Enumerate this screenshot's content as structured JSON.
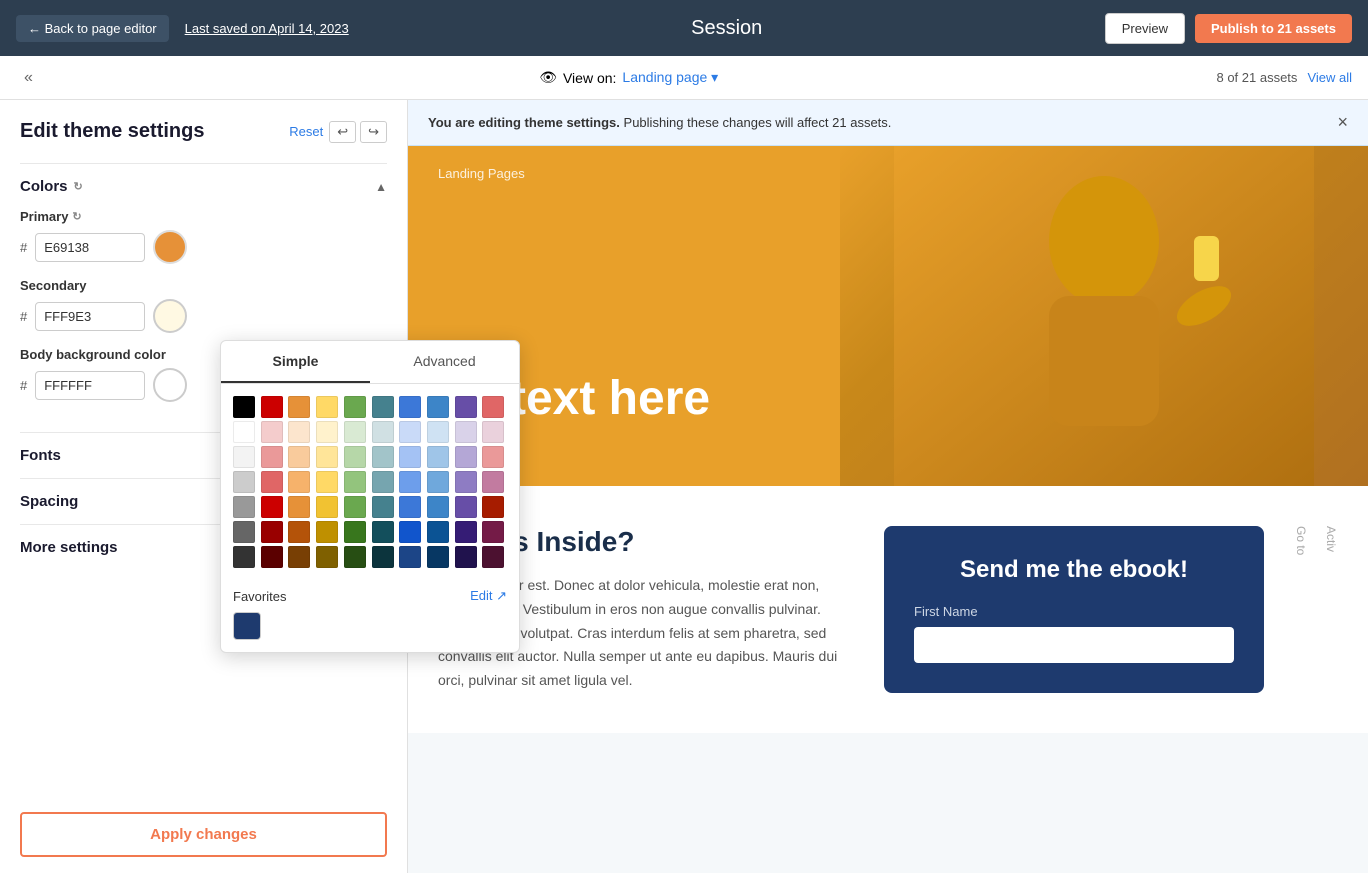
{
  "topbar": {
    "back_label": "← Back to page editor",
    "last_saved": "Last saved on April 14, 2023",
    "title": "Session",
    "preview_label": "Preview",
    "publish_label": "Publish to 21 assets"
  },
  "secondbar": {
    "collapse_icon": "«",
    "eye_icon": "👁",
    "view_on_prefix": "View on:",
    "view_on_value": "Landing page ▾",
    "assets_count": "8 of 21 assets",
    "view_all": "View all"
  },
  "sidebar": {
    "edit_theme_title": "Edit theme settings",
    "reset_label": "Reset",
    "undo_label": "↩",
    "redo_label": "↪",
    "sections": {
      "colors": {
        "label": "Colors",
        "chevron": "▲",
        "primary_label": "Primary",
        "primary_value": "E69138",
        "primary_color": "#E69138",
        "secondary_label": "Secondary",
        "secondary_value": "FFF9E3",
        "secondary_color": "#FFF9E3",
        "bg_label": "Body background color",
        "bg_value": "FFFFFF",
        "bg_color": "#FFFFFF"
      },
      "fonts": {
        "label": "Fonts",
        "chevron": "▶"
      },
      "spacing": {
        "label": "Spacing",
        "chevron": "▼"
      },
      "more": {
        "label": "More settings",
        "chevron": "›"
      }
    },
    "apply_label": "Apply changes"
  },
  "color_picker": {
    "tab_simple": "Simple",
    "tab_advanced": "Advanced",
    "favorites_label": "Favorites",
    "edit_label": "Edit ↗",
    "colors_row1": [
      "#000000",
      "#cc0000",
      "#e69138",
      "#ffd966",
      "#6aa84f",
      "#45818e",
      "#3c78d8",
      "#3d85c8",
      "#674ea7",
      "#e06666"
    ],
    "colors_row2": [
      "#ffffff",
      "#f4cccc",
      "#fce5cd",
      "#fff2cc",
      "#d9ead3",
      "#d0e0e3",
      "#c9daf8",
      "#cfe2f3",
      "#d9d2e9",
      "#ead1dc"
    ],
    "colors_row3": [
      "#f3f3f3",
      "#ea9999",
      "#f9cb9c",
      "#ffe599",
      "#b6d7a8",
      "#a2c4c9",
      "#a4c2f4",
      "#9fc5e8",
      "#b4a7d6",
      "#ea9999"
    ],
    "colors_row4": [
      "#cccccc",
      "#e06666",
      "#f6b26b",
      "#ffd966",
      "#93c47d",
      "#76a5af",
      "#6d9eeb",
      "#6fa8dc",
      "#8e7cc3",
      "#c27ba0"
    ],
    "colors_row5": [
      "#999999",
      "#cc0000",
      "#e69138",
      "#f1c232",
      "#6aa84f",
      "#45818e",
      "#3c78d8",
      "#3d85c8",
      "#674ea7",
      "#a61c00"
    ],
    "colors_row6": [
      "#666666",
      "#990000",
      "#b45309",
      "#bf9000",
      "#38761d",
      "#134f5c",
      "#1155cc",
      "#0b5394",
      "#351c75",
      "#741b47"
    ],
    "colors_row7": [
      "#333333",
      "#5b0000",
      "#783f04",
      "#7f6000",
      "#274e13",
      "#0c343d",
      "#1c4587",
      "#073763",
      "#20124d",
      "#4c1130"
    ],
    "favorite_color": "#1e3a6e"
  },
  "notification": {
    "bold_text": "You are editing theme settings.",
    "body_text": "Publishing these changes will affect 21 assets."
  },
  "preview": {
    "breadcrumb": "Landing Pages",
    "hero_text": "dd text here",
    "whats_inside_title": "What's Inside?",
    "body_paragraph": "Morbi et dolor est. Donec at dolor vehicula, molestie erat non, rutrum tellus. Vestibulum in eros non augue convallis pulvinar. Aliquam erat volutpat. Cras interdum felis at sem pharetra, sed convallis elit auctor. Nulla semper ut ante eu dapibus. Mauris dui orci, pulvinar sit amet ligula vel.",
    "ebook_title": "Send me the ebook!",
    "first_name_label": "First Name",
    "right_edge_top": "Activ",
    "right_edge_bottom": "Go to"
  }
}
